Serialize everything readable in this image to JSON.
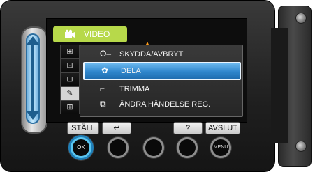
{
  "screen": {
    "tab_title": "VIDEO",
    "tab_icon": "video-camera-icon",
    "side_icons": [
      {
        "name": "settings-icon-1",
        "glyph": "⊞"
      },
      {
        "name": "settings-icon-2",
        "glyph": "⊡"
      },
      {
        "name": "settings-icon-3",
        "glyph": "⊟"
      },
      {
        "name": "edit-tool-icon",
        "glyph": "✎"
      },
      {
        "name": "settings-icon-5",
        "glyph": "⊞"
      }
    ],
    "menu_items": [
      {
        "label": "SKYDDA/AVBRYT",
        "icon": "key-icon",
        "glyph": "O‒"
      },
      {
        "label": "DELA",
        "icon": "share-icon",
        "glyph": "✿",
        "selected": true
      },
      {
        "label": "TRIMMA",
        "icon": "trim-icon",
        "glyph": "⌐"
      },
      {
        "label": "ÄNDRA HÄNDELSE REG.",
        "icon": "event-icon",
        "glyph": "⧉"
      }
    ],
    "accent_color": "#2f86cc",
    "tab_color": "#b7d94a"
  },
  "softkeys": {
    "stall": "STÄLL",
    "back_glyph": "↩",
    "help": "?",
    "quit": "AVSLUT"
  },
  "hardware": {
    "ok_label": "OK",
    "menu_label": "MENU"
  }
}
